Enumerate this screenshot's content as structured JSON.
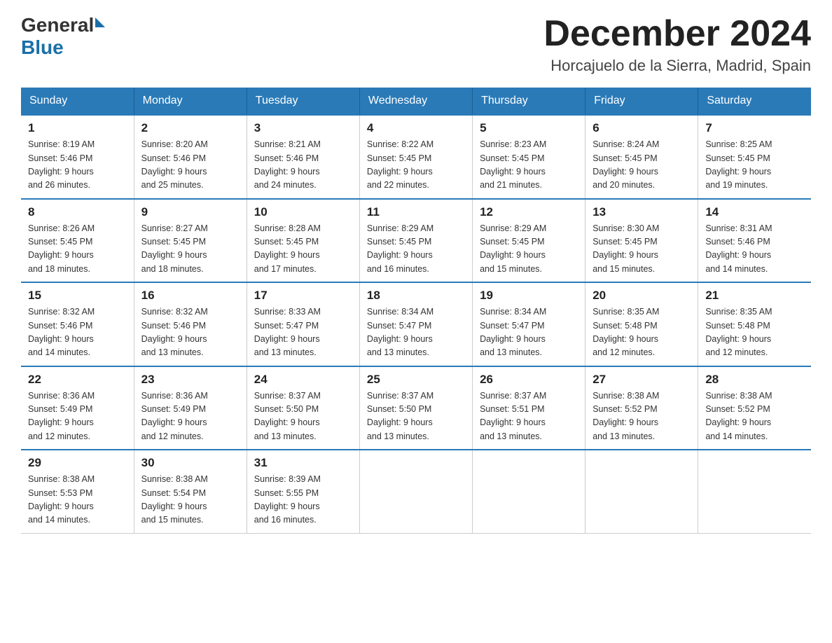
{
  "header": {
    "logo": {
      "text_general": "General",
      "arrow_color": "#1a6fa8",
      "text_blue": "Blue"
    },
    "title": "December 2024",
    "location": "Horcajuelo de la Sierra, Madrid, Spain"
  },
  "days_of_week": [
    "Sunday",
    "Monday",
    "Tuesday",
    "Wednesday",
    "Thursday",
    "Friday",
    "Saturday"
  ],
  "weeks": [
    [
      {
        "day": "1",
        "sunrise": "8:19 AM",
        "sunset": "5:46 PM",
        "daylight": "9 hours and 26 minutes."
      },
      {
        "day": "2",
        "sunrise": "8:20 AM",
        "sunset": "5:46 PM",
        "daylight": "9 hours and 25 minutes."
      },
      {
        "day": "3",
        "sunrise": "8:21 AM",
        "sunset": "5:46 PM",
        "daylight": "9 hours and 24 minutes."
      },
      {
        "day": "4",
        "sunrise": "8:22 AM",
        "sunset": "5:45 PM",
        "daylight": "9 hours and 22 minutes."
      },
      {
        "day": "5",
        "sunrise": "8:23 AM",
        "sunset": "5:45 PM",
        "daylight": "9 hours and 21 minutes."
      },
      {
        "day": "6",
        "sunrise": "8:24 AM",
        "sunset": "5:45 PM",
        "daylight": "9 hours and 20 minutes."
      },
      {
        "day": "7",
        "sunrise": "8:25 AM",
        "sunset": "5:45 PM",
        "daylight": "9 hours and 19 minutes."
      }
    ],
    [
      {
        "day": "8",
        "sunrise": "8:26 AM",
        "sunset": "5:45 PM",
        "daylight": "9 hours and 18 minutes."
      },
      {
        "day": "9",
        "sunrise": "8:27 AM",
        "sunset": "5:45 PM",
        "daylight": "9 hours and 18 minutes."
      },
      {
        "day": "10",
        "sunrise": "8:28 AM",
        "sunset": "5:45 PM",
        "daylight": "9 hours and 17 minutes."
      },
      {
        "day": "11",
        "sunrise": "8:29 AM",
        "sunset": "5:45 PM",
        "daylight": "9 hours and 16 minutes."
      },
      {
        "day": "12",
        "sunrise": "8:29 AM",
        "sunset": "5:45 PM",
        "daylight": "9 hours and 15 minutes."
      },
      {
        "day": "13",
        "sunrise": "8:30 AM",
        "sunset": "5:45 PM",
        "daylight": "9 hours and 15 minutes."
      },
      {
        "day": "14",
        "sunrise": "8:31 AM",
        "sunset": "5:46 PM",
        "daylight": "9 hours and 14 minutes."
      }
    ],
    [
      {
        "day": "15",
        "sunrise": "8:32 AM",
        "sunset": "5:46 PM",
        "daylight": "9 hours and 14 minutes."
      },
      {
        "day": "16",
        "sunrise": "8:32 AM",
        "sunset": "5:46 PM",
        "daylight": "9 hours and 13 minutes."
      },
      {
        "day": "17",
        "sunrise": "8:33 AM",
        "sunset": "5:47 PM",
        "daylight": "9 hours and 13 minutes."
      },
      {
        "day": "18",
        "sunrise": "8:34 AM",
        "sunset": "5:47 PM",
        "daylight": "9 hours and 13 minutes."
      },
      {
        "day": "19",
        "sunrise": "8:34 AM",
        "sunset": "5:47 PM",
        "daylight": "9 hours and 13 minutes."
      },
      {
        "day": "20",
        "sunrise": "8:35 AM",
        "sunset": "5:48 PM",
        "daylight": "9 hours and 12 minutes."
      },
      {
        "day": "21",
        "sunrise": "8:35 AM",
        "sunset": "5:48 PM",
        "daylight": "9 hours and 12 minutes."
      }
    ],
    [
      {
        "day": "22",
        "sunrise": "8:36 AM",
        "sunset": "5:49 PM",
        "daylight": "9 hours and 12 minutes."
      },
      {
        "day": "23",
        "sunrise": "8:36 AM",
        "sunset": "5:49 PM",
        "daylight": "9 hours and 12 minutes."
      },
      {
        "day": "24",
        "sunrise": "8:37 AM",
        "sunset": "5:50 PM",
        "daylight": "9 hours and 13 minutes."
      },
      {
        "day": "25",
        "sunrise": "8:37 AM",
        "sunset": "5:50 PM",
        "daylight": "9 hours and 13 minutes."
      },
      {
        "day": "26",
        "sunrise": "8:37 AM",
        "sunset": "5:51 PM",
        "daylight": "9 hours and 13 minutes."
      },
      {
        "day": "27",
        "sunrise": "8:38 AM",
        "sunset": "5:52 PM",
        "daylight": "9 hours and 13 minutes."
      },
      {
        "day": "28",
        "sunrise": "8:38 AM",
        "sunset": "5:52 PM",
        "daylight": "9 hours and 14 minutes."
      }
    ],
    [
      {
        "day": "29",
        "sunrise": "8:38 AM",
        "sunset": "5:53 PM",
        "daylight": "9 hours and 14 minutes."
      },
      {
        "day": "30",
        "sunrise": "8:38 AM",
        "sunset": "5:54 PM",
        "daylight": "9 hours and 15 minutes."
      },
      {
        "day": "31",
        "sunrise": "8:39 AM",
        "sunset": "5:55 PM",
        "daylight": "9 hours and 16 minutes."
      },
      null,
      null,
      null,
      null
    ]
  ]
}
